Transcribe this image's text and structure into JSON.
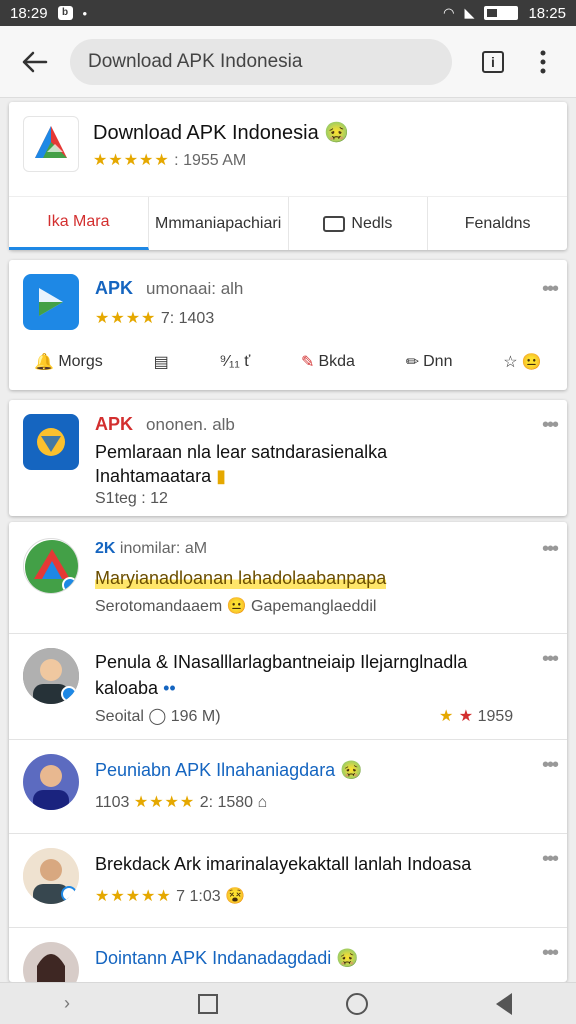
{
  "status": {
    "time_left": "18:29",
    "time_right": "18:25"
  },
  "search": {
    "query": "Download APK Indonesia"
  },
  "app": {
    "title": "Download APK Indonesia",
    "title_emoji": "🤢",
    "stars": "★★★★★",
    "rating_text": ": 1955 AM"
  },
  "tabs": [
    {
      "label": "Ika Mara"
    },
    {
      "label": "Mmmaniapachiari"
    },
    {
      "label": "Nedls"
    },
    {
      "label": "Fenaldns"
    }
  ],
  "item1": {
    "title": "APK",
    "meta": "umonaai: alh",
    "stars": "★★★★",
    "rating_text": "7: 1403",
    "actions": [
      "Morgs",
      "",
      "⁹⁄₁₁ ť",
      "Bkda",
      "Dnn",
      ""
    ]
  },
  "item2": {
    "title": "APK",
    "meta": "ononen. alb",
    "desc1": "Pemlaraan nla lear satndarasienalka",
    "desc2": "Inahtamaatara",
    "desc3": "S1teg : 12"
  },
  "list": [
    {
      "line1a": "2K",
      "line1b": "inomilar: aM",
      "line2": "Maryianadloanan lahadolaabanpapa",
      "line3": "Serotomandaaem",
      "line3b": "Gapemanglaeddil"
    },
    {
      "line1": "Penula & INasalllarlagbantneiaip Ilejarnglnadla",
      "line2": "kaloaba",
      "line3": "Seoital",
      "line3b": "196 M)",
      "line3c": "1959"
    },
    {
      "line1": "Peuniabn APK Ilnahaniagdara",
      "stars": "★★★★",
      "line2": "1103",
      "line2b": "2: 1580"
    },
    {
      "line1": "Brekdack Ark imarinalayekaktall lanlah Indoasa",
      "stars": "★★★★★",
      "line2": "7 1:03"
    },
    {
      "line1": "Dointann APK Indanadagdadi"
    }
  ]
}
